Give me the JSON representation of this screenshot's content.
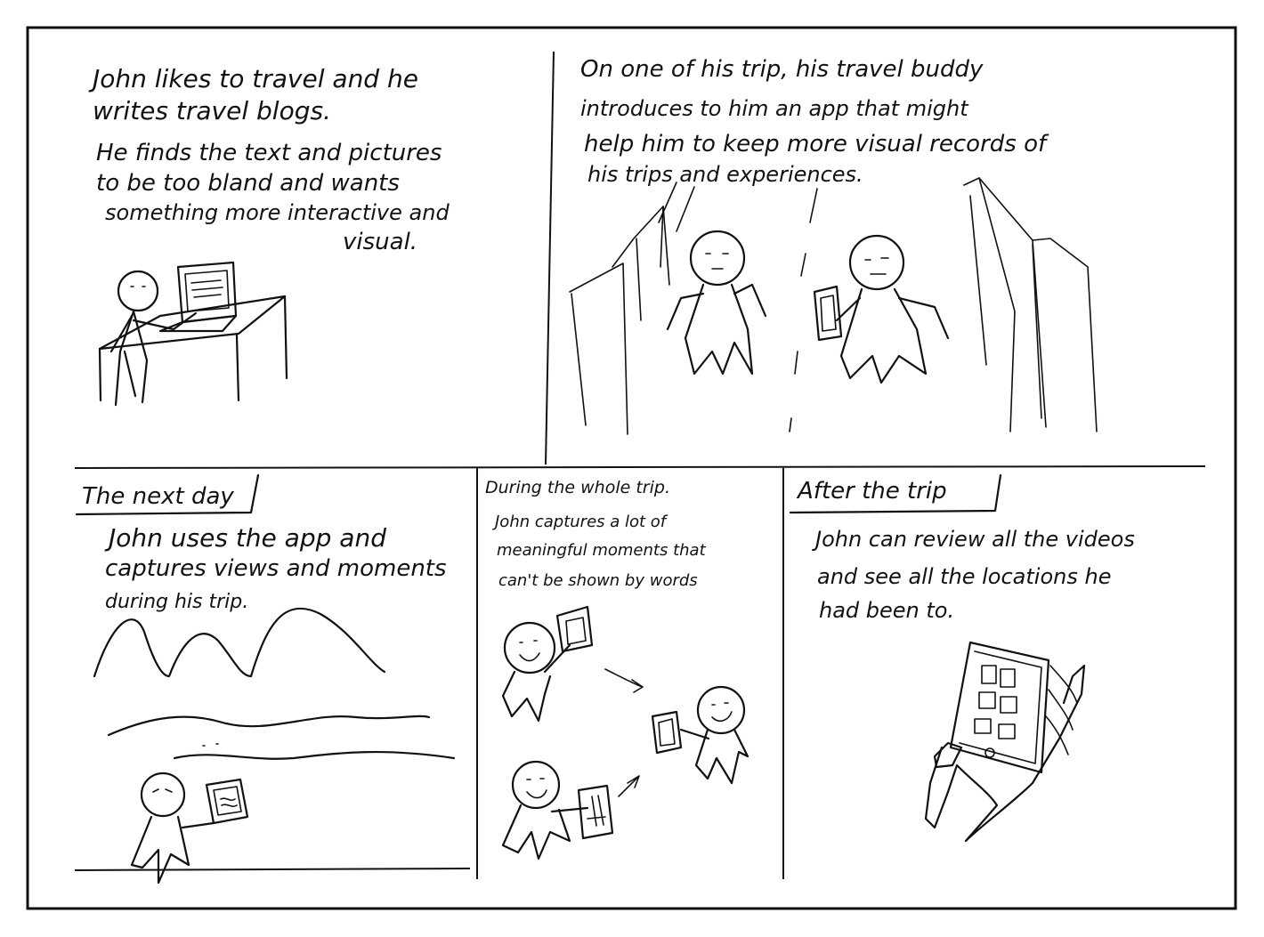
{
  "panel1": {
    "lines": [
      "John likes to travel and he",
      "writes travel blogs.",
      "He finds the text and pictures",
      "to be too bland and wants",
      "something more interactive and",
      "visual."
    ]
  },
  "panel2": {
    "lines": [
      "On one of his trip, his travel buddy",
      "introduces to him an app that might",
      "help him to keep more visual records of",
      "his trips and experiences."
    ]
  },
  "panel3": {
    "heading": "The next day",
    "lines": [
      "John uses the app and",
      "captures views and moments",
      "during his trip."
    ]
  },
  "panel4": {
    "heading": "During the whole trip.",
    "lines": [
      "John captures a lot of",
      "meaningful moments that",
      "can't be shown by words"
    ]
  },
  "panel5": {
    "heading": "After the trip",
    "lines": [
      "John can review all the videos",
      "and see all the locations he",
      "had been to."
    ]
  },
  "icons": [
    "desk-laptop-sketch",
    "travelers-sketch",
    "mountains-river-sketch",
    "selfie-sketch",
    "phone-grid-sketch"
  ],
  "colors": {
    "ink": "#111111",
    "paper": "#ffffff"
  }
}
